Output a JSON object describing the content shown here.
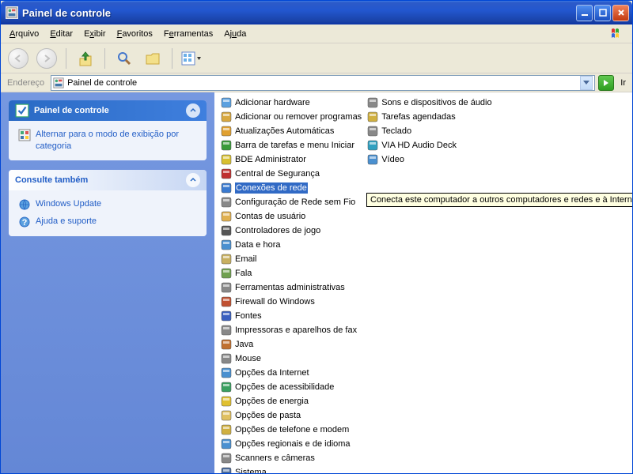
{
  "window": {
    "title": "Painel de controle"
  },
  "menu": {
    "arquivo": "Arquivo",
    "editar": "Editar",
    "exibir": "Exibir",
    "favoritos": "Favoritos",
    "ferramentas": "Ferramentas",
    "ajuda": "Ajuda"
  },
  "addressbar": {
    "label": "Endereço",
    "value": "Painel de controle",
    "go": "Ir"
  },
  "sidebar": {
    "panel1": {
      "title": "Painel de controle",
      "link1": "Alternar para o modo de exibição por categoria"
    },
    "panel2": {
      "title": "Consulte também",
      "link1": "Windows Update",
      "link2": "Ajuda e suporte"
    }
  },
  "items_col1": [
    "Adicionar hardware",
    "Adicionar ou remover programas",
    "Atualizações Automáticas",
    "Barra de tarefas e menu Iniciar",
    "BDE Administrator",
    "Central de Segurança",
    "Conexões de rede",
    "Configuração de Rede sem Fio",
    "Contas de usuário",
    "Controladores de jogo",
    "Data e hora",
    "Email",
    "Fala",
    "Ferramentas administrativas",
    "Firewall do Windows",
    "Fontes",
    "Impressoras e aparelhos de fax",
    "Java",
    "Mouse",
    "Opções da Internet",
    "Opções de acessibilidade",
    "Opções de energia",
    "Opções de pasta",
    "Opções de telefone e modem",
    "Opções regionais e de idioma",
    "Scanners e câmeras",
    "Sistema"
  ],
  "items_col2": [
    "Sons e dispositivos de áudio",
    "Tarefas agendadas",
    "Teclado",
    "VIA HD Audio Deck",
    "Vídeo"
  ],
  "selected_index": 6,
  "tooltip": "Conecta este computador a outros computadores e redes e à Internet"
}
